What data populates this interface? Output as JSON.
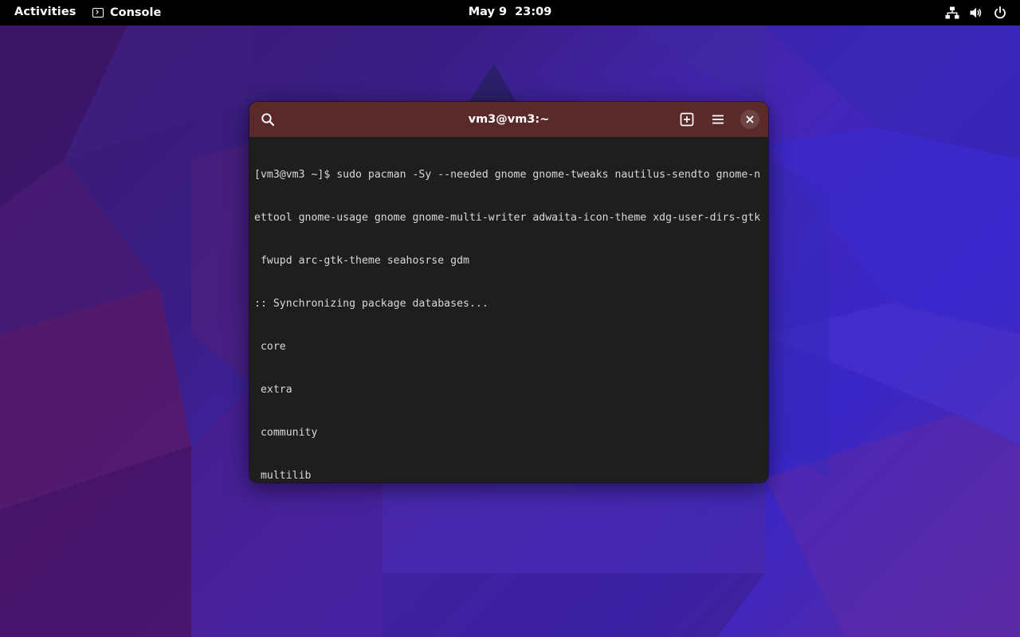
{
  "topbar": {
    "activities_label": "Activities",
    "app_name": "Console",
    "app_icon": "terminal-icon",
    "clock": "May 9  23:09",
    "status_icons": [
      "network-wired-icon",
      "volume-icon",
      "power-icon"
    ]
  },
  "window": {
    "title": "vm3@vm3:~",
    "header_color": "#5a2a2a",
    "buttons": {
      "search_icon": "search-icon",
      "new_tab_icon": "new-tab-icon",
      "menu_icon": "hamburger-menu-icon",
      "close_icon": "close-icon"
    }
  },
  "terminal": {
    "background": "#1e1e1e",
    "lines": [
      "[vm3@vm3 ~]$ sudo pacman -Sy --needed gnome gnome-tweaks nautilus-sendto gnome-n",
      "ettool gnome-usage gnome gnome-multi-writer adwaita-icon-theme xdg-user-dirs-gtk",
      " fwupd arc-gtk-theme seahosrse gdm",
      ":: Synchronizing package databases...",
      " core",
      " extra",
      " community",
      " multilib"
    ]
  }
}
